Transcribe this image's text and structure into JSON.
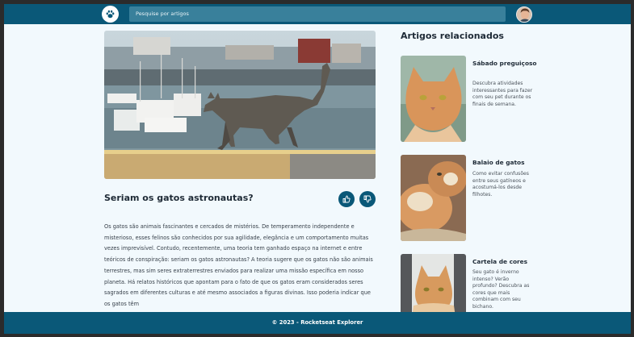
{
  "header": {
    "search_placeholder": "Pesquise por artigos",
    "logo_icon": "paw-icon",
    "avatar_icon": "user-avatar"
  },
  "article": {
    "title": "Seriam os gatos astronautas?",
    "paragraph": "Os gatos são animais fascinantes e cercados de mistérios. De temperamento independente e misterioso, esses felinos são conhecidos por sua agilidade, elegância e um comportamento muitas vezes imprevisível. Contudo, recentemente, uma teoria tem ganhado espaço na internet e entre teóricos de conspiração: seriam os gatos astronautas? A teoria sugere que os gatos não são animais terrestres, mas sim seres extraterrestres enviados para realizar uma missão específica em nosso planeta. Há relatos históricos que apontam para o fato de que os gatos eram considerados seres sagrados em diferentes culturas e até mesmo associados a figuras divinas. Isso poderia indicar que os gatos têm",
    "like_icon": "thumbs-up-icon",
    "dislike_icon": "thumbs-down-icon"
  },
  "sidebar": {
    "title": "Artigos relacionados",
    "cards": [
      {
        "title": "Sábado preguiçoso",
        "description": "Descubra atividades interessantes para fazer com seu pet durante os finais de semana."
      },
      {
        "title": "Balaio de gatos",
        "description": "Como evitar confusões entre seus gatíneos e acostumá-los desde filhotes."
      },
      {
        "title": "Cartela de cores",
        "description": "Seu gato é inverno intenso? Verão profundo? Descubra as cores que mais combinam com seu bichano."
      }
    ]
  },
  "footer": {
    "text": "© 2023 - Rocketseat Explorer"
  },
  "colors": {
    "primary": "#0a5878",
    "background": "#f2f9fd"
  }
}
